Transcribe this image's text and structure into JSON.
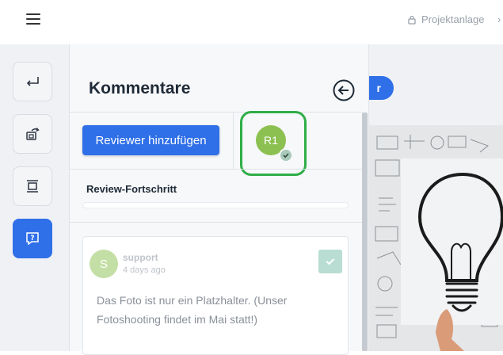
{
  "header": {
    "breadcrumb": "Projektanlage",
    "breadcrumb_next": "›"
  },
  "sidebar": {
    "items": [
      {
        "name": "return-icon"
      },
      {
        "name": "share-icon"
      },
      {
        "name": "crop-icon"
      },
      {
        "name": "comment-question-icon",
        "active": true
      }
    ]
  },
  "canvas": {
    "button_label": "r"
  },
  "panel": {
    "title": "Kommentare",
    "add_reviewer_label": "Reviewer hinzufügen",
    "reviewer": {
      "initials": "R1",
      "status": "approved"
    },
    "progress_label": "Review-Fortschritt",
    "progress_value": 0
  },
  "comment": {
    "avatar_initial": "S",
    "author": "support",
    "time": "4 days ago",
    "text": "Das Foto ist nur ein Platzhalter. (Unser Fotoshooting findet im Mai statt!)"
  },
  "colors": {
    "primary": "#2f6fe8",
    "highlight": "#2fae47",
    "reviewer_avatar": "#8cc152",
    "comment_avatar": "#c4dfa6"
  }
}
